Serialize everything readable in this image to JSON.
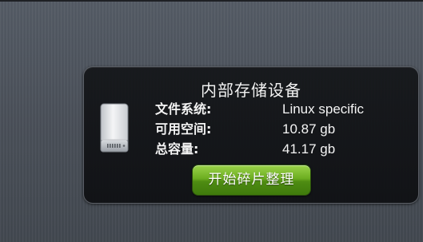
{
  "storage_card": {
    "title": "内部存储设备",
    "icon": "hard-drive-icon",
    "rows": [
      {
        "label": "文件系统:",
        "value": "Linux specific"
      },
      {
        "label": "可用空间:",
        "value": "10.87 gb"
      },
      {
        "label": "总容量:",
        "value": "41.17 gb"
      }
    ],
    "defrag_button_label": "开始碎片整理"
  },
  "colors": {
    "card_background": "#141619",
    "button_green": "#6cad20",
    "text": "#f4f4f4"
  }
}
